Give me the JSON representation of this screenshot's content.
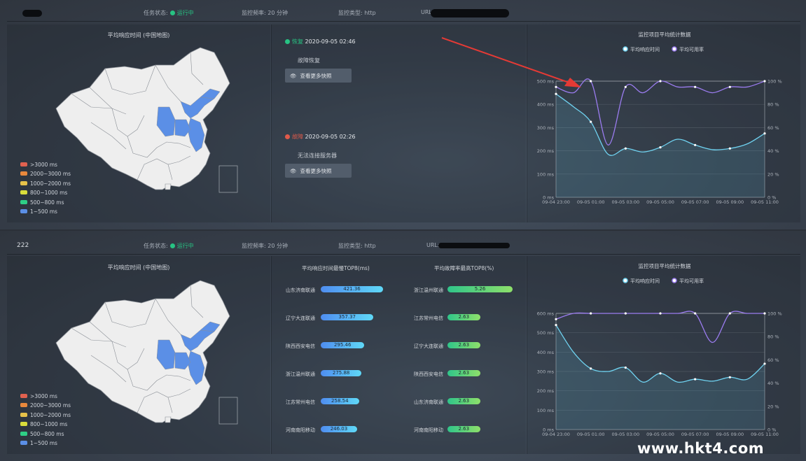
{
  "colors": {
    "accent": "#27c383",
    "fault": "#e05a4a",
    "resp": "#6fd2f0",
    "avail": "#9b7cf0"
  },
  "monitors": [
    {
      "name": "",
      "status_label": "任务状态:",
      "status_value": "运行中",
      "freq_label": "监控频率:",
      "freq_value": "20 分钟",
      "type_label": "监控类型:",
      "type_value": "http",
      "url_label": "URL:"
    },
    {
      "name": "222",
      "status_label": "任务状态:",
      "status_value": "运行中",
      "freq_label": "监控频率:",
      "freq_value": "20 分钟",
      "type_label": "监控类型:",
      "type_value": "http",
      "url_label": "URL:"
    }
  ],
  "map_title": "平均响应时间 (中国地图)",
  "map_legend": [
    {
      "label": ">3000 ms",
      "color": "#e0614f"
    },
    {
      "label": "2000~3000 ms",
      "color": "#e8883c"
    },
    {
      "label": "1000~2000 ms",
      "color": "#e6c24a"
    },
    {
      "label": "800~1000 ms",
      "color": "#d9dd3b"
    },
    {
      "label": "500~800 ms",
      "color": "#2ecf86"
    },
    {
      "label": "1~500 ms",
      "color": "#5b8fe6"
    }
  ],
  "events": [
    {
      "type": "恢复",
      "time": "2020-09-05 02:46",
      "desc": "故障恢复",
      "button": "查看更多快照",
      "color": "#27c383"
    },
    {
      "type": "故障",
      "time": "2020-09-05 02:26",
      "desc": "无法连接服务器",
      "button": "查看更多快照",
      "color": "#e05a4a"
    }
  ],
  "rank_resp": {
    "title": "平均响应时间最慢TOP8(ms)",
    "items": [
      {
        "name": "山东济南联通",
        "value": 421.36
      },
      {
        "name": "辽宁大连联通",
        "value": 357.37
      },
      {
        "name": "陕西西安电信",
        "value": 295.46
      },
      {
        "name": "浙江温州联通",
        "value": 275.88
      },
      {
        "name": "江苏常州电信",
        "value": 258.54
      },
      {
        "name": "河南南阳移动",
        "value": 246.03
      }
    ]
  },
  "rank_fault": {
    "title": "平均故障率最高TOP8(%)",
    "items": [
      {
        "name": "浙江温州联通",
        "value": 5.26
      },
      {
        "name": "江苏常州电信",
        "value": 2.63
      },
      {
        "name": "辽宁大连联通",
        "value": 2.63
      },
      {
        "name": "陕西西安电信",
        "value": 2.63
      },
      {
        "name": "山东济南联通",
        "value": 2.63
      },
      {
        "name": "河南南阳移动",
        "value": 2.63
      }
    ]
  },
  "chart_data": [
    {
      "type": "line",
      "title": "监控项目平均统计数据",
      "categories": [
        "09-04 23:00",
        "09-05 00:00",
        "09-05 01:00",
        "09-05 02:00",
        "09-05 03:00",
        "09-05 04:00",
        "09-05 05:00",
        "09-05 06:00",
        "09-05 07:00",
        "09-05 08:00",
        "09-05 09:00",
        "09-05 10:00",
        "09-05 11:00"
      ],
      "tick_labels": [
        "09-04 23:00",
        "09-05 01:00",
        "09-05 03:00",
        "09-05 05:00",
        "09-05 07:00",
        "09-05 09:00",
        "09-05 11:00"
      ],
      "series": [
        {
          "name": "平均响应时间",
          "axis": "left",
          "values": [
            445,
            390,
            325,
            185,
            210,
            195,
            215,
            250,
            225,
            205,
            210,
            230,
            275
          ]
        },
        {
          "name": "平均可用率",
          "axis": "right",
          "values": [
            95,
            90,
            100,
            45,
            95,
            90,
            100,
            95,
            95,
            90,
            95,
            95,
            100
          ]
        }
      ],
      "ylim_left": [
        0,
        500
      ],
      "yticks_left": [
        "0 ms",
        "100 ms",
        "200 ms",
        "300 ms",
        "400 ms",
        "500 ms"
      ],
      "ylim_right": [
        0,
        100
      ],
      "yticks_right": [
        "0 %",
        "20 %",
        "40 %",
        "60 %",
        "80 %",
        "100 %"
      ],
      "legend_position": "top-center",
      "grid": true
    },
    {
      "type": "line",
      "title": "监控项目平均统计数据",
      "categories": [
        "09-04 23:00",
        "09-05 00:00",
        "09-05 01:00",
        "09-05 02:00",
        "09-05 03:00",
        "09-05 04:00",
        "09-05 05:00",
        "09-05 06:00",
        "09-05 07:00",
        "09-05 08:00",
        "09-05 09:00",
        "09-05 10:00",
        "09-05 11:00"
      ],
      "tick_labels": [
        "09-04 23:00",
        "09-05 01:00",
        "09-05 03:00",
        "09-05 05:00",
        "09-05 07:00",
        "09-05 09:00",
        "09-05 11:00"
      ],
      "series": [
        {
          "name": "平均响应时间",
          "axis": "left",
          "values": [
            540,
            400,
            315,
            300,
            320,
            245,
            290,
            245,
            260,
            250,
            270,
            260,
            340
          ]
        },
        {
          "name": "平均可用率",
          "axis": "right",
          "values": [
            95,
            100,
            100,
            100,
            100,
            100,
            100,
            100,
            100,
            75,
            100,
            100,
            100
          ]
        }
      ],
      "ylim_left": [
        0,
        600
      ],
      "yticks_left": [
        "0 ms",
        "100 ms",
        "200 ms",
        "300 ms",
        "400 ms",
        "500 ms",
        "600 ms"
      ],
      "ylim_right": [
        0,
        100
      ],
      "yticks_right": [
        "0 %",
        "20 %",
        "40 %",
        "60 %",
        "80 %",
        "100 %"
      ],
      "legend_position": "top-center",
      "grid": true
    }
  ],
  "watermark": "www.hkt4.com"
}
